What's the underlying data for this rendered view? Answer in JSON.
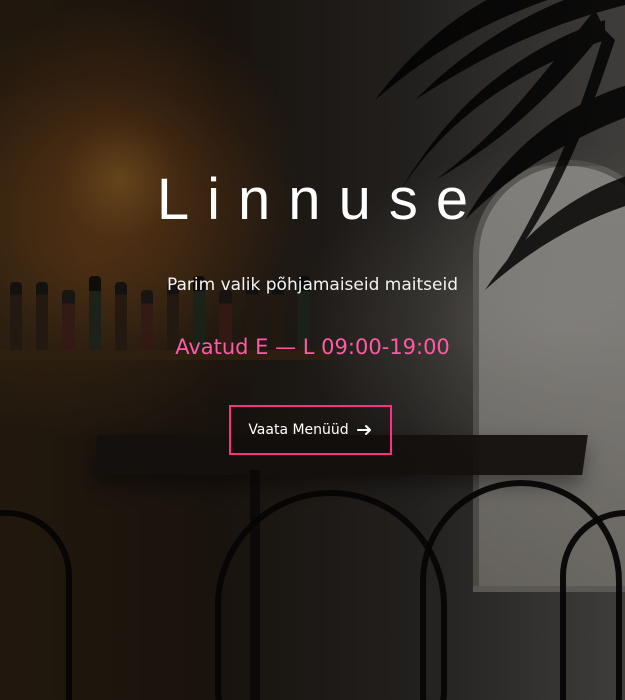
{
  "hero": {
    "title": "Linnuse",
    "tagline": "Parim valik põhjamaiseid maitseid",
    "hours": "Avatud E — L 09:00-19:00",
    "cta_label": "Vaata Menüüd",
    "cta_icon": "arrow-right-icon"
  },
  "colors": {
    "accent": "#ff2f86",
    "hours_text": "#ff5aa5"
  }
}
